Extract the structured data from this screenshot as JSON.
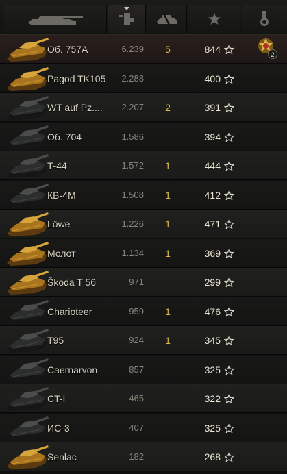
{
  "header": {
    "columns": [
      {
        "icon": "tank-icon"
      },
      {
        "icon": "rating-icon",
        "sorted": true
      },
      {
        "icon": "count-icon"
      },
      {
        "icon": "star-icon"
      },
      {
        "icon": "medal-icon"
      }
    ]
  },
  "rows": [
    {
      "name": "Об. 757А",
      "rating": "6.239",
      "count": "5",
      "battles": "844",
      "medal": {
        "count": "2"
      },
      "style": "top",
      "tint": "gold"
    },
    {
      "name": "Pagod TK105",
      "rating": "2.288",
      "count": "",
      "battles": "400",
      "style": "even",
      "tint": "gold"
    },
    {
      "name": "WT auf Pz....",
      "rating": "2.207",
      "count": "2",
      "battles": "391",
      "style": "odd",
      "tint": "dark"
    },
    {
      "name": "Об. 704",
      "rating": "1.586",
      "count": "",
      "battles": "394",
      "style": "even",
      "tint": "dark"
    },
    {
      "name": "Т-44",
      "rating": "1.572",
      "count": "1",
      "battles": "444",
      "style": "odd",
      "tint": "dark"
    },
    {
      "name": "КВ-4М",
      "rating": "1.508",
      "count": "1",
      "battles": "412",
      "style": "even",
      "tint": "dark"
    },
    {
      "name": "Löwe",
      "rating": "1.226",
      "count": "1",
      "battles": "471",
      "style": "odd",
      "tint": "gold"
    },
    {
      "name": "Молот",
      "rating": "1.134",
      "count": "1",
      "battles": "369",
      "style": "even",
      "tint": "gold"
    },
    {
      "name": "Škoda T 56",
      "rating": "971",
      "count": "",
      "battles": "299",
      "style": "odd",
      "tint": "gold"
    },
    {
      "name": "Charioteer",
      "rating": "959",
      "count": "1",
      "battles": "476",
      "style": "even",
      "tint": "dark"
    },
    {
      "name": "T95",
      "rating": "924",
      "count": "1",
      "battles": "345",
      "style": "odd",
      "tint": "dark"
    },
    {
      "name": "Caernarvon",
      "rating": "857",
      "count": "",
      "battles": "325",
      "style": "even",
      "tint": "dark"
    },
    {
      "name": "CT-I",
      "rating": "465",
      "count": "",
      "battles": "322",
      "style": "odd",
      "tint": "dark"
    },
    {
      "name": "ИС-3",
      "rating": "407",
      "count": "",
      "battles": "325",
      "style": "even",
      "tint": "dark"
    },
    {
      "name": "Senlac",
      "rating": "182",
      "count": "",
      "battles": "268",
      "style": "odd",
      "tint": "gold"
    }
  ],
  "colors": {
    "gold_tank": "#b8862a",
    "dark_tank": "#3a3d3b",
    "count": "#d9b84a",
    "battles": "#e8e4d3",
    "rating": "#88857a"
  }
}
